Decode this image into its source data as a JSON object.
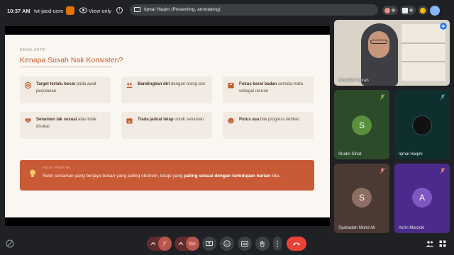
{
  "topbar": {
    "time": "10:37 AM",
    "separator": "|",
    "meeting_code": "tvt-jacd-uem",
    "view_mode": "View only",
    "info_glyph": "i",
    "presenting_label": "Iqmal Haqim (Presenting, annotating)",
    "account_initial": "",
    "colors": {
      "badge": "#e37400",
      "avatar": "#8ab4f8"
    }
  },
  "slide": {
    "kicker": "KEKAL AKTIF",
    "title": "Kenapa Susah Nak Konsisten?",
    "cards": [
      {
        "bold": "Target terlalu besar",
        "rest": " pada awal perjalanan",
        "icon": "target-icon"
      },
      {
        "bold": "Bandingkan diri",
        "rest": " dengan orang lain",
        "icon": "people-icon"
      },
      {
        "bold": "Fokus berat badan",
        "rest": " semata-mata sebagai ukuran",
        "icon": "scale-icon"
      },
      {
        "bold": "Senaman tak sesuai",
        "rest": " atau tidak disukai",
        "icon": "broken-heart-icon"
      },
      {
        "bold": "Tiada jadual tetap",
        "rest": " untuk senaman",
        "icon": "calendar-icon"
      },
      {
        "bold": "Putus asa",
        "rest": " bila progress lambat",
        "icon": "sad-face-icon"
      }
    ],
    "callout": {
      "kicker": "POINT PENTING",
      "text_before": "Rutin senaman yang berjaya bukan yang paling ekstrem, tetapi yang ",
      "text_bold": "paling sesuai dengan kehidupan harian",
      "text_after": " kita.",
      "icon": "lightbulb-icon"
    },
    "colors": {
      "accent": "#c75a2c",
      "callout_bg": "#c85a35",
      "card_bg": "#f1ebe3",
      "slide_bg": "#faf7f2"
    }
  },
  "participants": [
    {
      "name": "Sharifah Amirah",
      "initial": "",
      "type": "video"
    },
    {
      "name": "Studio Sihat",
      "initial": "S",
      "avatar_color": "#5a8f3e",
      "tile_bg": "#2d4a2a"
    },
    {
      "name": "Iqmal Haqim",
      "initial": "",
      "avatar_color": "#111111",
      "tile_bg": "#0f2e2e"
    },
    {
      "name": "Syahadah Mohd Ali",
      "initial": "S",
      "avatar_color": "#8d6e63",
      "tile_bg": "#4a3a33"
    },
    {
      "name": "Azrin Marzuki",
      "initial": "A",
      "avatar_color": "#7e57c2",
      "tile_bg": "#4a2a8a"
    }
  ],
  "controls": {
    "items": [
      "mic-off-button",
      "camera-off-button",
      "present-button",
      "emoji-button",
      "captions-button",
      "raise-hand-button",
      "more-options-button",
      "leave-call-button"
    ],
    "colors": {
      "leave": "#ea4335",
      "off": "#f28b82"
    }
  }
}
